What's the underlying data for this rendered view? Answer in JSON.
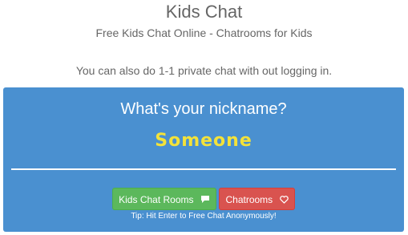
{
  "header": {
    "title": "Kids Chat",
    "subtitle": "Free Kids Chat Online - Chatrooms for Kids",
    "note": "You can also do 1-1 private chat with out logging in."
  },
  "panel": {
    "heading": "What's your nickname?",
    "nickname_value": "Someone",
    "buttons": {
      "rooms_label": "Kids Chat Rooms",
      "rooms_icon": "comment-icon",
      "chatrooms_label": "Chatrooms",
      "chatrooms_icon": "heart-icon"
    },
    "tip": "Tip: Hit Enter to Free Chat Anonymously!"
  },
  "colors": {
    "panel_bg": "#4a90d0",
    "nickname_text": "#f3e23a",
    "rooms_button": "#5cb85c",
    "chatrooms_button": "#d9534f",
    "muted_text": "#666666"
  }
}
